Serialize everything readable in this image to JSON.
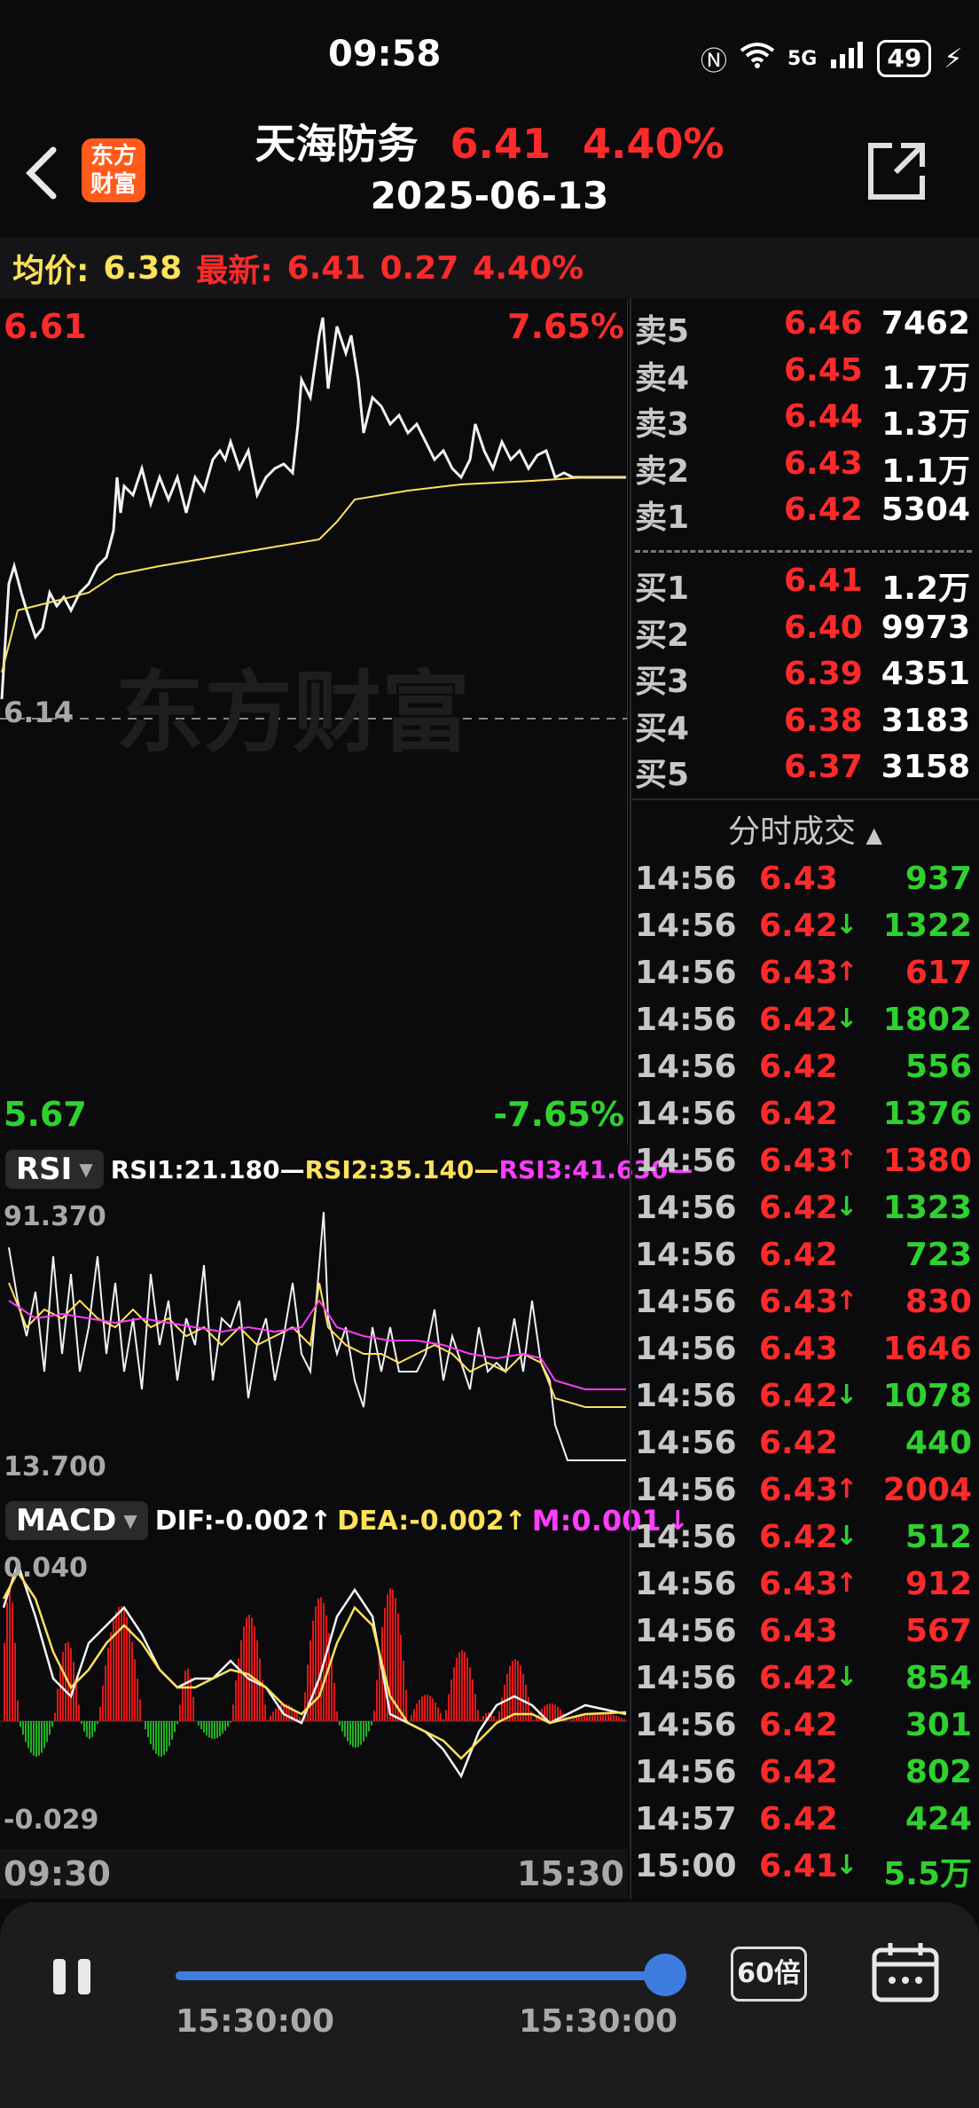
{
  "status_bar": {
    "time": "09:58",
    "network": "5G",
    "battery": "49"
  },
  "header": {
    "logo_line1": "东方",
    "logo_line2": "财富",
    "stock_name": "天海防务",
    "price": "6.41",
    "change_pct": "4.40%",
    "date": "2025-06-13"
  },
  "infobar": {
    "avg_label": "均价:",
    "avg_value": "6.38",
    "latest_label": "最新:",
    "latest_price": "6.41",
    "change": "0.27",
    "change_pct": "4.40%"
  },
  "main_chart": {
    "y_high": "6.61",
    "y_high_pct": "7.65%",
    "y_base": "6.14",
    "y_low": "5.67",
    "y_low_pct": "-7.65%",
    "watermark": "东方财富",
    "x_start": "09:30",
    "x_end": "15:30"
  },
  "rsi": {
    "tag": "RSI",
    "rsi1": "RSI1:21.180",
    "rsi2": "RSI2:35.140",
    "rsi3": "RSI3:41.630",
    "y_max": "91.370",
    "y_min": "13.700"
  },
  "macd": {
    "tag": "MACD",
    "dif": "DIF:-0.002",
    "dea": "DEA:-0.002",
    "m": "M:0.001",
    "y_max": "0.040",
    "y_min": "-0.029"
  },
  "orderbook": {
    "asks": [
      {
        "label": "卖5",
        "price": "6.46",
        "vol": "7462"
      },
      {
        "label": "卖4",
        "price": "6.45",
        "vol": "1.7万"
      },
      {
        "label": "卖3",
        "price": "6.44",
        "vol": "1.3万"
      },
      {
        "label": "卖2",
        "price": "6.43",
        "vol": "1.1万"
      },
      {
        "label": "卖1",
        "price": "6.42",
        "vol": "5304"
      }
    ],
    "bids": [
      {
        "label": "买1",
        "price": "6.41",
        "vol": "1.2万"
      },
      {
        "label": "买2",
        "price": "6.40",
        "vol": "9973"
      },
      {
        "label": "买3",
        "price": "6.39",
        "vol": "4351"
      },
      {
        "label": "买4",
        "price": "6.38",
        "vol": "3183"
      },
      {
        "label": "买5",
        "price": "6.37",
        "vol": "3158"
      }
    ]
  },
  "trades": {
    "title": "分时成交",
    "rows": [
      {
        "t": "14:56",
        "p": "6.43",
        "a": "",
        "v": "937",
        "c": "green"
      },
      {
        "t": "14:56",
        "p": "6.42",
        "a": "↓",
        "v": "1322",
        "c": "green"
      },
      {
        "t": "14:56",
        "p": "6.43",
        "a": "↑",
        "v": "617",
        "c": "red"
      },
      {
        "t": "14:56",
        "p": "6.42",
        "a": "↓",
        "v": "1802",
        "c": "green"
      },
      {
        "t": "14:56",
        "p": "6.42",
        "a": "",
        "v": "556",
        "c": "green"
      },
      {
        "t": "14:56",
        "p": "6.42",
        "a": "",
        "v": "1376",
        "c": "green"
      },
      {
        "t": "14:56",
        "p": "6.43",
        "a": "↑",
        "v": "1380",
        "c": "red"
      },
      {
        "t": "14:56",
        "p": "6.42",
        "a": "↓",
        "v": "1323",
        "c": "green"
      },
      {
        "t": "14:56",
        "p": "6.42",
        "a": "",
        "v": "723",
        "c": "green"
      },
      {
        "t": "14:56",
        "p": "6.43",
        "a": "↑",
        "v": "830",
        "c": "red"
      },
      {
        "t": "14:56",
        "p": "6.43",
        "a": "",
        "v": "1646",
        "c": "red"
      },
      {
        "t": "14:56",
        "p": "6.42",
        "a": "↓",
        "v": "1078",
        "c": "green"
      },
      {
        "t": "14:56",
        "p": "6.42",
        "a": "",
        "v": "440",
        "c": "green"
      },
      {
        "t": "14:56",
        "p": "6.43",
        "a": "↑",
        "v": "2004",
        "c": "red"
      },
      {
        "t": "14:56",
        "p": "6.42",
        "a": "↓",
        "v": "512",
        "c": "green"
      },
      {
        "t": "14:56",
        "p": "6.43",
        "a": "↑",
        "v": "912",
        "c": "red"
      },
      {
        "t": "14:56",
        "p": "6.43",
        "a": "",
        "v": "567",
        "c": "red"
      },
      {
        "t": "14:56",
        "p": "6.42",
        "a": "↓",
        "v": "854",
        "c": "green"
      },
      {
        "t": "14:56",
        "p": "6.42",
        "a": "",
        "v": "301",
        "c": "green"
      },
      {
        "t": "14:56",
        "p": "6.42",
        "a": "",
        "v": "802",
        "c": "green"
      },
      {
        "t": "14:57",
        "p": "6.42",
        "a": "",
        "v": "424",
        "c": "green"
      },
      {
        "t": "15:00",
        "p": "6.41",
        "a": "↓",
        "v": "5.5万",
        "c": "green"
      }
    ]
  },
  "controls": {
    "time_left": "15:30:00",
    "time_right": "15:30:00",
    "speed": "60倍",
    "progress": 1.0
  },
  "colors": {
    "up": "#ff2a2a",
    "down": "#2fd12f",
    "avg": "#ffe25a",
    "accent": "#3d7de0"
  }
}
